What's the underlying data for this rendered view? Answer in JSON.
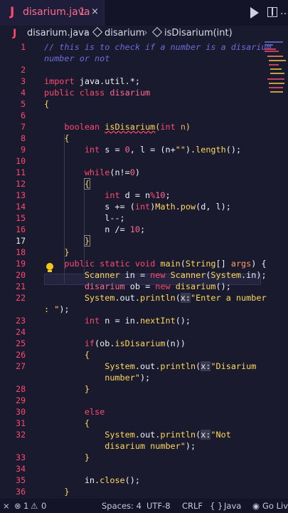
{
  "tab": {
    "icon": "J",
    "name": "disarium.java",
    "modified": "1",
    "close": "×"
  },
  "breadcrumb": {
    "file": "disarium.java",
    "class": "disarium",
    "method": "isDisarium(int)"
  },
  "line_numbers": [
    "1",
    "",
    "2",
    "3",
    "4",
    "5",
    "6",
    "7",
    "8",
    "9",
    "10",
    "11",
    "12",
    "13",
    "14",
    "15",
    "16",
    "17",
    "18",
    "19",
    "20",
    "21",
    "22",
    "",
    "23",
    "24",
    "25",
    "26",
    "27",
    "",
    "28",
    "29",
    "30",
    "31",
    "32",
    "",
    "33",
    "34",
    "35",
    "36"
  ],
  "status": {
    "errors": "1",
    "warnings": "0",
    "spaces": "Spaces: 4",
    "encoding": "UTF-8",
    "eol": "CRLF",
    "braces": "{ }",
    "language": "Java",
    "golive": "Go Live"
  }
}
